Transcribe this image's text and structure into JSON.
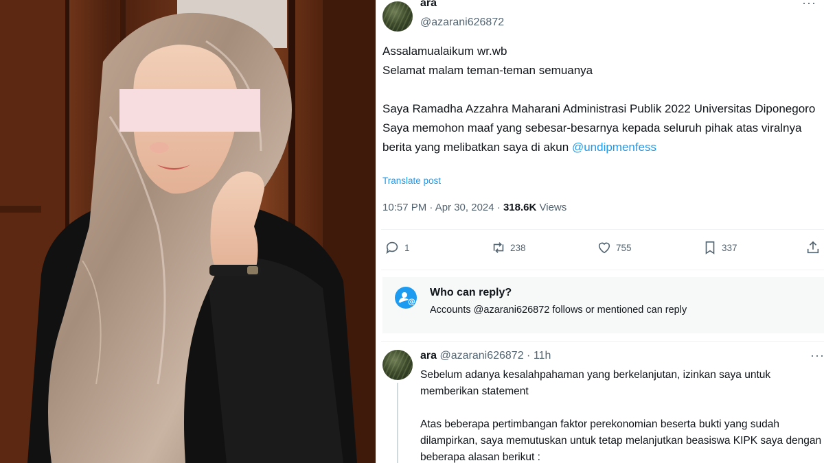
{
  "photo": {
    "description_icon": "person-photo",
    "censor_color": "#f7dde0"
  },
  "tweet": {
    "author_name": "ara",
    "author_handle": "@azarani626872",
    "more_label": "···",
    "body_lines": [
      "Assalamualaikum wr.wb",
      "Selamat malam teman-teman semuanya",
      "",
      "Saya Ramadha Azzahra Maharani Administrasi Publik 2022 Universitas Diponegoro",
      "Saya memohon maaf yang sebesar-besarnya kepada seluruh pihak atas viralnya berita yang melibatkan saya di akun "
    ],
    "mention": "@undipmenfess",
    "translate_label": "Translate post",
    "time": "10:57 PM · Apr 30, 2024",
    "separator": " · ",
    "views_count": "318.6K",
    "views_label": "Views",
    "actions": {
      "reply_count": "1",
      "retweet_count": "238",
      "like_count": "755",
      "bookmark_count": "337"
    },
    "who_can_reply": {
      "title": "Who can reply?",
      "desc": "Accounts @azarani626872 follows or mentioned can reply"
    },
    "reply": {
      "name": "ara",
      "handle": "@azarani626872",
      "time": "11h",
      "body": "Sebelum adanya kesalahpahaman yang berkelanjutan, izinkan saya untuk memberikan statement\n\nAtas beberapa pertimbangan faktor perekonomian beserta bukti yang sudah dilampirkan, saya memutuskan untuk tetap melanjutkan beasiswa KIPK saya dengan beberapa alasan berikut :"
    }
  },
  "colors": {
    "accent": "#1d9bf0",
    "secondary_text": "#536471",
    "primary_text": "#0f1419"
  }
}
